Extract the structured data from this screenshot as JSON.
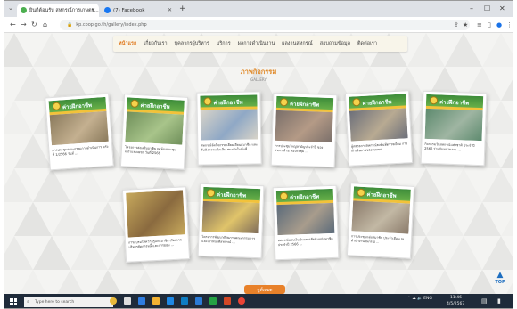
{
  "browser": {
    "tabs": [
      {
        "title": "ยินดีต้อนรับ สหกรณ์การเกษตร...",
        "active": true
      },
      {
        "title": "(7) Facebook",
        "active": false
      }
    ],
    "address": "kp.coop.go.th/gallery/index.php",
    "win_min": "–",
    "win_max": "☐",
    "win_close": "✕"
  },
  "site": {
    "nav": [
      "หน้าแรก",
      "เกี่ยวกับเรา",
      "บุคลากรผู้บริหาร",
      "บริการ",
      "ผลการดำเนินงาน",
      "ผลงานสหกรณ์",
      "สอบถามข้อมูล",
      "ติดต่อเรา"
    ],
    "active_nav_index": 0,
    "heading": "ภาพกิจกรรม",
    "subheading": "GALLERY",
    "banner_title": "ค่ายฝึกอาชีพ",
    "more_button": "ดูทั้งหมด",
    "to_top": "TOP"
  },
  "cards": [
    {
      "caption": "การประชุมคณะกรรมการดำเนินการ ครั้งที่ 1/2566 วันที่ ..."
    },
    {
      "caption": "โครงการส่งเสริมอาชีพ ณ ห้องประชุม จ.กำแพงเพชร วันที่ 2566"
    },
    {
      "caption": "สหกรณ์จัดกิจกรรมเยี่ยมเยียนสมาชิก และรับฟังความคิดเห็น สมาชิกในพื้นที่ ..."
    },
    {
      "caption": "การประชุมใหญ่สามัญประจำปี ของสหกรณ์ ณ หอประชุม ..."
    },
    {
      "caption": "ผู้ตรวจการสหกรณ์ลงพื้นที่ตรวจเยี่ยม การดำเนินงานของสหกรณ์ ..."
    },
    {
      "caption": "กิจกรรมวันสหกรณ์แห่งชาติ ประจำปี 2566 ร่วมกับหน่วยงาน ..."
    },
    {
      "caption": "การอบรมให้ความรู้แก่สมาชิก เรื่องการบริหารจัดการหนี้ และการออม ..."
    },
    {
      "caption": "โครงการพัฒนาศักยภาพคณะกรรมการ และเจ้าหน้าที่สหกรณ์ ..."
    },
    {
      "caption": "สหกรณ์มอบเงินปันผลเฉลี่ยคืนแก่สมาชิก ประจำปี 2566 ..."
    },
    {
      "caption": "การประชุมกลุ่มสมาชิก ประจำเดือน ณ สำนักงานสหกรณ์ ..."
    }
  ],
  "taskbar": {
    "search_placeholder": "Type here to search",
    "tray_text": "^ ☁ 🔈 ENG",
    "time": "11:46",
    "date": "4/5/2567"
  },
  "colors": {
    "accent": "#e8812a",
    "banner_green": "#3d8c3a",
    "taskbar": "#1f2b3a"
  }
}
